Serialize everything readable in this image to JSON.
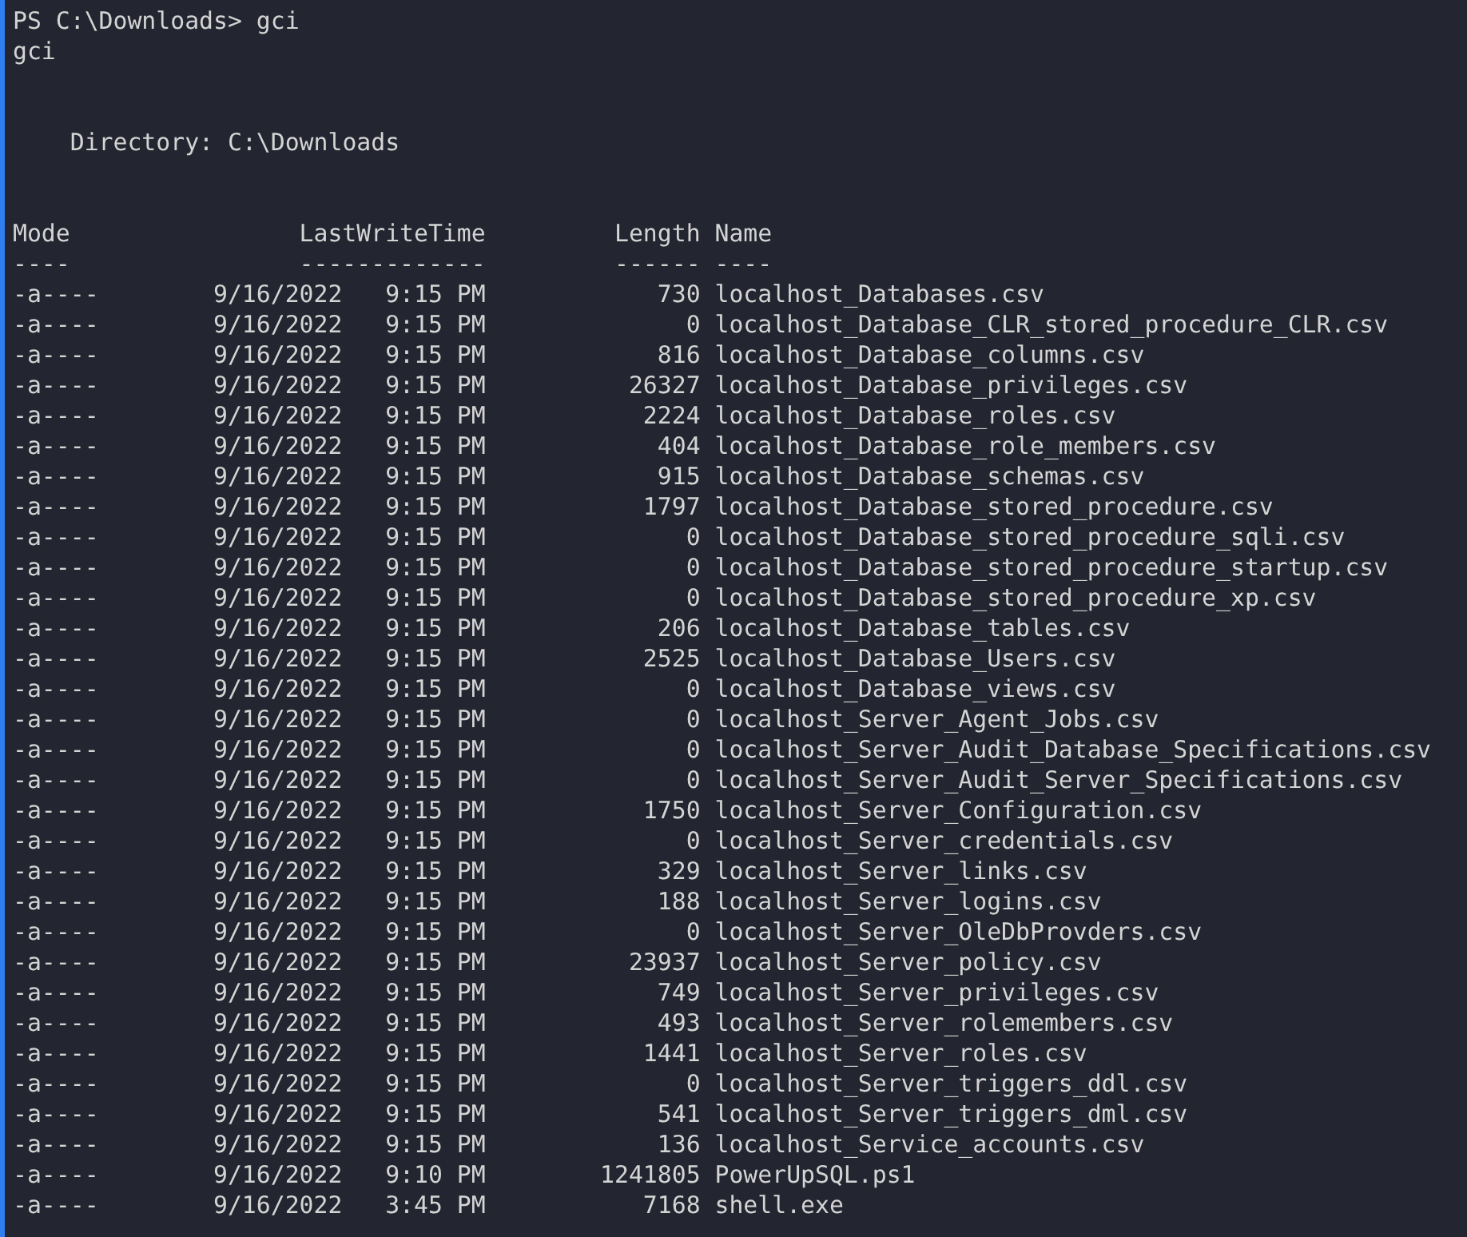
{
  "prompt": "PS C:\\Downloads> gci",
  "echo": "gci",
  "directory": "Directory: C:\\Downloads",
  "columns": [
    {
      "header": "Mode",
      "rule": "----"
    },
    {
      "header": "LastWriteTime",
      "rule": "-------------"
    },
    {
      "header": "Length",
      "rule": "------"
    },
    {
      "header": "Name",
      "rule": "----"
    }
  ],
  "rows": [
    {
      "mode": "-a----",
      "date": "9/16/2022",
      "time": "9:15 PM",
      "length": "730",
      "name": "localhost_Databases.csv"
    },
    {
      "mode": "-a----",
      "date": "9/16/2022",
      "time": "9:15 PM",
      "length": "0",
      "name": "localhost_Database_CLR_stored_procedure_CLR.csv"
    },
    {
      "mode": "-a----",
      "date": "9/16/2022",
      "time": "9:15 PM",
      "length": "816",
      "name": "localhost_Database_columns.csv"
    },
    {
      "mode": "-a----",
      "date": "9/16/2022",
      "time": "9:15 PM",
      "length": "26327",
      "name": "localhost_Database_privileges.csv"
    },
    {
      "mode": "-a----",
      "date": "9/16/2022",
      "time": "9:15 PM",
      "length": "2224",
      "name": "localhost_Database_roles.csv"
    },
    {
      "mode": "-a----",
      "date": "9/16/2022",
      "time": "9:15 PM",
      "length": "404",
      "name": "localhost_Database_role_members.csv"
    },
    {
      "mode": "-a----",
      "date": "9/16/2022",
      "time": "9:15 PM",
      "length": "915",
      "name": "localhost_Database_schemas.csv"
    },
    {
      "mode": "-a----",
      "date": "9/16/2022",
      "time": "9:15 PM",
      "length": "1797",
      "name": "localhost_Database_stored_procedure.csv"
    },
    {
      "mode": "-a----",
      "date": "9/16/2022",
      "time": "9:15 PM",
      "length": "0",
      "name": "localhost_Database_stored_procedure_sqli.csv"
    },
    {
      "mode": "-a----",
      "date": "9/16/2022",
      "time": "9:15 PM",
      "length": "0",
      "name": "localhost_Database_stored_procedure_startup.csv"
    },
    {
      "mode": "-a----",
      "date": "9/16/2022",
      "time": "9:15 PM",
      "length": "0",
      "name": "localhost_Database_stored_procedure_xp.csv"
    },
    {
      "mode": "-a----",
      "date": "9/16/2022",
      "time": "9:15 PM",
      "length": "206",
      "name": "localhost_Database_tables.csv"
    },
    {
      "mode": "-a----",
      "date": "9/16/2022",
      "time": "9:15 PM",
      "length": "2525",
      "name": "localhost_Database_Users.csv"
    },
    {
      "mode": "-a----",
      "date": "9/16/2022",
      "time": "9:15 PM",
      "length": "0",
      "name": "localhost_Database_views.csv"
    },
    {
      "mode": "-a----",
      "date": "9/16/2022",
      "time": "9:15 PM",
      "length": "0",
      "name": "localhost_Server_Agent_Jobs.csv"
    },
    {
      "mode": "-a----",
      "date": "9/16/2022",
      "time": "9:15 PM",
      "length": "0",
      "name": "localhost_Server_Audit_Database_Specifications.csv"
    },
    {
      "mode": "-a----",
      "date": "9/16/2022",
      "time": "9:15 PM",
      "length": "0",
      "name": "localhost_Server_Audit_Server_Specifications.csv"
    },
    {
      "mode": "-a----",
      "date": "9/16/2022",
      "time": "9:15 PM",
      "length": "1750",
      "name": "localhost_Server_Configuration.csv"
    },
    {
      "mode": "-a----",
      "date": "9/16/2022",
      "time": "9:15 PM",
      "length": "0",
      "name": "localhost_Server_credentials.csv"
    },
    {
      "mode": "-a----",
      "date": "9/16/2022",
      "time": "9:15 PM",
      "length": "329",
      "name": "localhost_Server_links.csv"
    },
    {
      "mode": "-a----",
      "date": "9/16/2022",
      "time": "9:15 PM",
      "length": "188",
      "name": "localhost_Server_logins.csv"
    },
    {
      "mode": "-a----",
      "date": "9/16/2022",
      "time": "9:15 PM",
      "length": "0",
      "name": "localhost_Server_OleDbProvders.csv"
    },
    {
      "mode": "-a----",
      "date": "9/16/2022",
      "time": "9:15 PM",
      "length": "23937",
      "name": "localhost_Server_policy.csv"
    },
    {
      "mode": "-a----",
      "date": "9/16/2022",
      "time": "9:15 PM",
      "length": "749",
      "name": "localhost_Server_privileges.csv"
    },
    {
      "mode": "-a----",
      "date": "9/16/2022",
      "time": "9:15 PM",
      "length": "493",
      "name": "localhost_Server_rolemembers.csv"
    },
    {
      "mode": "-a----",
      "date": "9/16/2022",
      "time": "9:15 PM",
      "length": "1441",
      "name": "localhost_Server_roles.csv"
    },
    {
      "mode": "-a----",
      "date": "9/16/2022",
      "time": "9:15 PM",
      "length": "0",
      "name": "localhost_Server_triggers_ddl.csv"
    },
    {
      "mode": "-a----",
      "date": "9/16/2022",
      "time": "9:15 PM",
      "length": "541",
      "name": "localhost_Server_triggers_dml.csv"
    },
    {
      "mode": "-a----",
      "date": "9/16/2022",
      "time": "9:15 PM",
      "length": "136",
      "name": "localhost_Service_accounts.csv"
    },
    {
      "mode": "-a----",
      "date": "9/16/2022",
      "time": "9:10 PM",
      "length": "1241805",
      "name": "PowerUpSQL.ps1"
    },
    {
      "mode": "-a----",
      "date": "9/16/2022",
      "time": "3:45 PM",
      "length": "7168",
      "name": "shell.exe"
    }
  ]
}
